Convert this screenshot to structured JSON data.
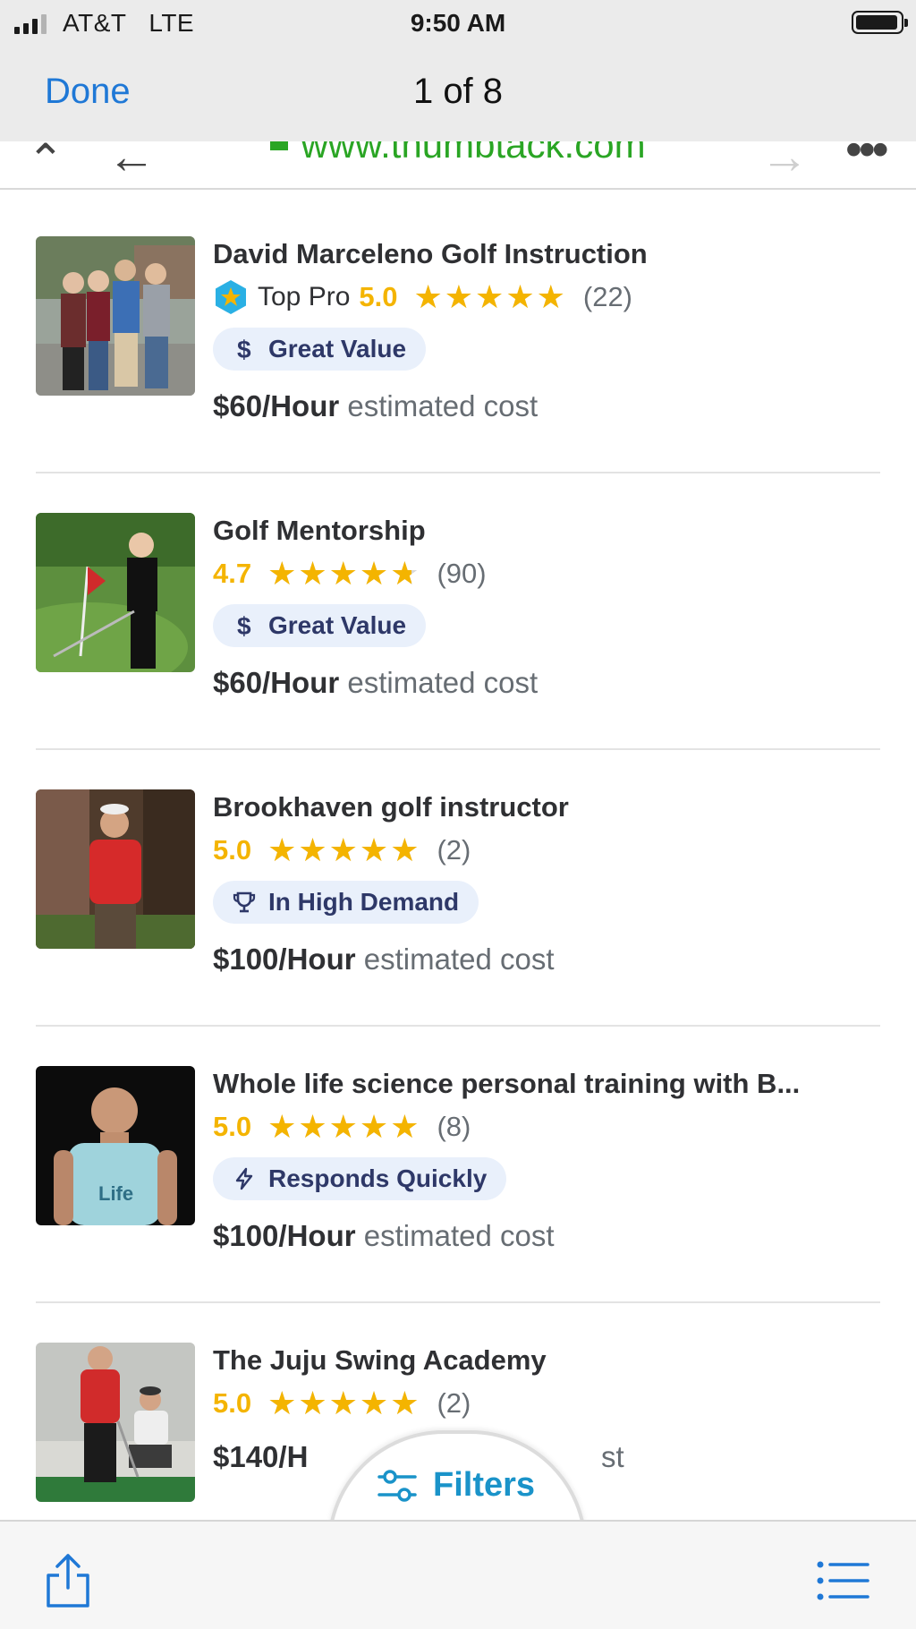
{
  "status_bar": {
    "carrier": "AT&T",
    "network": "LTE",
    "time": "9:50 AM"
  },
  "nav": {
    "done_label": "Done",
    "page_counter": "1 of 8"
  },
  "browser": {
    "url": "www.thumbtack.com"
  },
  "pros": [
    {
      "name": "David Marceleno Golf Instruction",
      "top_pro": true,
      "top_pro_label": "Top Pro",
      "score": "5.0",
      "rating_fraction": 1.0,
      "review_count": "(22)",
      "badge_icon": "dollar-icon",
      "badge": "Great Value",
      "price": "$60/Hour",
      "price_suffix": "estimated cost"
    },
    {
      "name": "Golf Mentorship",
      "top_pro": false,
      "score": "4.7",
      "rating_fraction": 0.94,
      "review_count": "(90)",
      "badge_icon": "dollar-icon",
      "badge": "Great Value",
      "price": "$60/Hour",
      "price_suffix": "estimated cost"
    },
    {
      "name": "Brookhaven golf instructor",
      "top_pro": false,
      "score": "5.0",
      "rating_fraction": 1.0,
      "review_count": "(2)",
      "badge_icon": "trophy-icon",
      "badge": "In High Demand",
      "price": "$100/Hour",
      "price_suffix": "estimated cost"
    },
    {
      "name": "Whole life science personal training with B...",
      "top_pro": false,
      "score": "5.0",
      "rating_fraction": 1.0,
      "review_count": "(8)",
      "badge_icon": "lightning-icon",
      "badge": "Responds Quickly",
      "price": "$100/Hour",
      "price_suffix": "estimated cost"
    },
    {
      "name": "The Juju Swing Academy",
      "top_pro": false,
      "score": "5.0",
      "rating_fraction": 1.0,
      "review_count": "(2)",
      "price": "$140/H",
      "price_suffix": "st"
    }
  ],
  "filters": {
    "label": "Filters",
    "icon": "sliders-icon"
  },
  "toolbar": {
    "share_icon": "share-icon",
    "list_icon": "list-icon"
  },
  "colors": {
    "star": "#f4b400",
    "link": "#1f78d6",
    "url": "#2aa524",
    "badge_bg": "#e9f0fb",
    "badge_text": "#2e3868",
    "filters": "#1a93c9"
  }
}
